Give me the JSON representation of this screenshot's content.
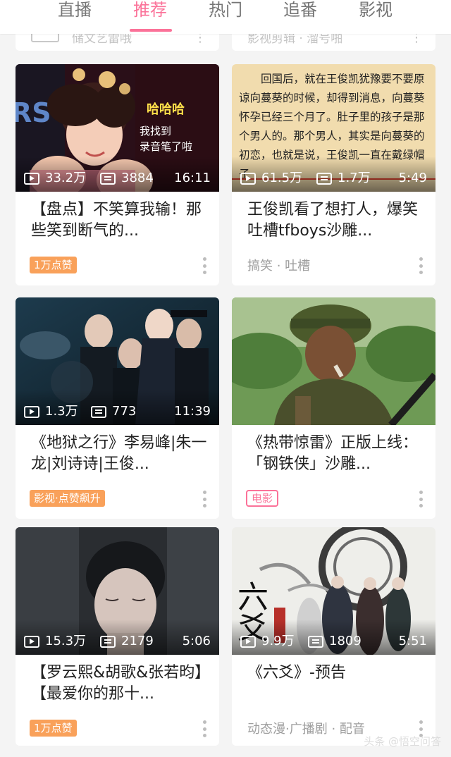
{
  "tabs": [
    {
      "label": "直播"
    },
    {
      "label": "推荐"
    },
    {
      "label": "热门"
    },
    {
      "label": "追番"
    },
    {
      "label": "影视"
    }
  ],
  "active_tab": "推荐",
  "colors": {
    "accent": "#fb7299",
    "tag_orange": "#f9a15a",
    "background": "#f4f4f4"
  },
  "partial_cards": [
    {
      "text": "储文艺雷哦"
    },
    {
      "text": "影视剪辑 · 溜号啪"
    }
  ],
  "cards": [
    {
      "views": "33.2万",
      "danmaku": "3884",
      "duration": "16:11",
      "title": "【盘点】不笑算我输！那些笑到断气的...",
      "tag": "1万点赞",
      "thumb_caption": "哈哈哈",
      "thumb_caption2": "我找到",
      "thumb_caption3": "录音笔了啦"
    },
    {
      "views": "61.5万",
      "danmaku": "1.7万",
      "duration": "5:49",
      "title": "王俊凯看了想打人，爆笑吐槽tfboys沙雕...",
      "category": "搞笑 · 吐槽",
      "thumb_text": "回国后，就在王俊凯犹豫要不要原谅向蔓葵的时候，却得到消息，向蔓葵怀孕已经三个月了。肚子里的孩子是那个男人的。那个男人，其实是向蔓葵的初恋，也就是说，王俊凯一直在戴绿帽子"
    },
    {
      "views": "1.3万",
      "danmaku": "773",
      "duration": "11:39",
      "title": "《地狱之行》李易峰|朱一龙|刘诗诗|王俊...",
      "tag": "影视·点赞飙升"
    },
    {
      "views": "",
      "danmaku": "",
      "duration": "",
      "title": "《热带惊雷》正版上线：「钢铁侠」沙雕...",
      "tag": "电影"
    },
    {
      "views": "15.3万",
      "danmaku": "2179",
      "duration": "5:06",
      "title": "【罗云熙&胡歌&张若昀】【最爱你的那十...",
      "tag": "1万点赞"
    },
    {
      "views": "9.9万",
      "danmaku": "1809",
      "duration": "5:51",
      "title": "《六爻》-预告",
      "category": "动态漫·广播剧 · 配音",
      "thumb_vertical": "六爻"
    }
  ],
  "watermark": "头条 @悟空问答"
}
